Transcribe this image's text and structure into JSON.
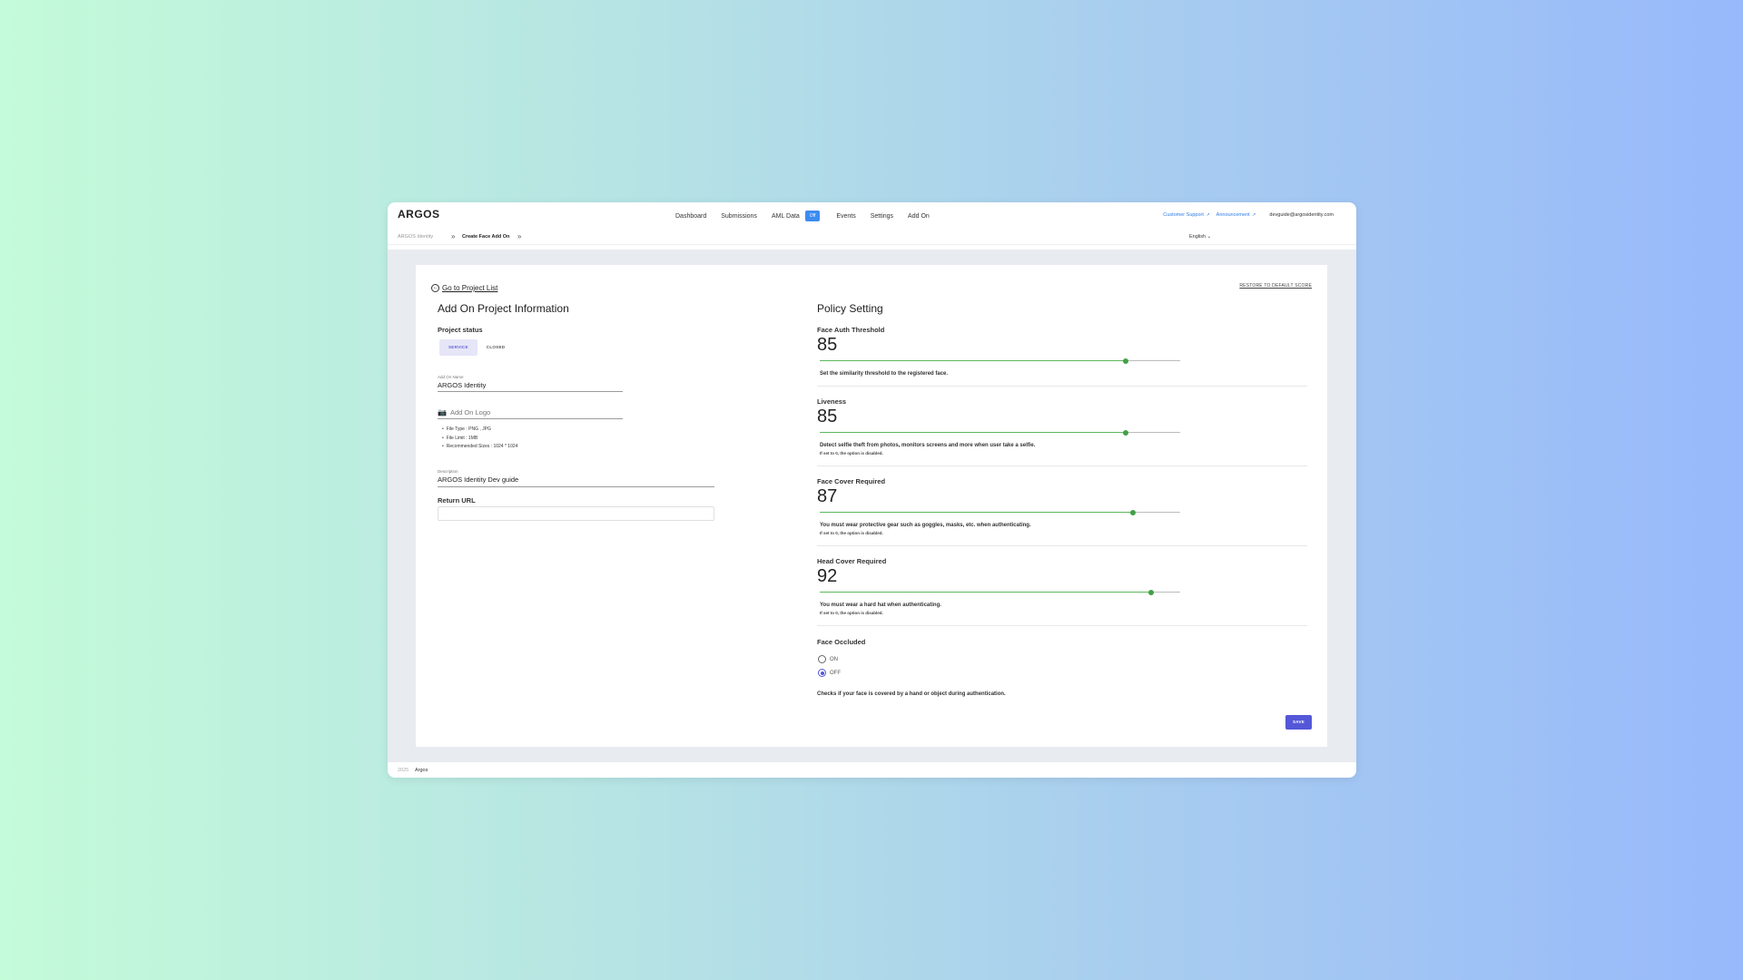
{
  "header": {
    "logo": "ARGOS",
    "nav": {
      "dashboard": "Dashboard",
      "submissions": "Submissions",
      "aml_data": "AML Data",
      "aml_badge": "Off",
      "events": "Events",
      "settings": "Settings",
      "add_on": "Add On"
    },
    "customer_support": "Customer Support",
    "announcement": "Announcement",
    "email": "devguide@argosidentity.com"
  },
  "breadcrumb": {
    "root": "ARGOS Identity",
    "current": "Create Face Add On"
  },
  "language": "English",
  "back_link": "Go to Project List",
  "restore_label": "RESTORE TO DEFAULT SCORE",
  "info": {
    "title": "Add On Project Information",
    "status_label": "Project status",
    "status_options": [
      "SERVICE",
      "CLOSED"
    ],
    "status_selected": "SERVICE",
    "name_label": "Add On Name",
    "name_value": "ARGOS Identity",
    "logo_label": "Add On Logo",
    "logo_notes": [
      "File Type : PNG , JPG",
      "File Limit : 1MB",
      "Recommended Sizes : 1024 * 1024"
    ],
    "description_label": "Description",
    "description_value": "ARGOS Identity Dev guide",
    "return_url_label": "Return URL",
    "return_url_value": ""
  },
  "policy": {
    "title": "Policy Setting",
    "face_auth": {
      "title": "Face Auth Threshold",
      "value": "85",
      "level": 85,
      "desc": "Set the similarity threshold to the registered face."
    },
    "liveness": {
      "title": "Liveness",
      "value": "85",
      "level": 85,
      "desc": "Detect selfie theft from photos, monitors screens and more when user take a selfie.",
      "note": "If set to 0, the option is disabled."
    },
    "face_cover": {
      "title": "Face Cover Required",
      "value": "87",
      "level": 87,
      "desc": "You must wear protective gear such as goggles, masks, etc. when authenticating.",
      "note": "If set to 0, the option is disabled."
    },
    "head_cover": {
      "title": "Head Cover Required",
      "value": "92",
      "level": 92,
      "desc": "You must wear a hard hat when authenticating.",
      "note": "If set to 0, the option is disabled."
    },
    "face_occluded": {
      "title": "Face Occluded",
      "options": [
        "ON",
        "OFF"
      ],
      "selected": "OFF",
      "desc": "Checks if your face is covered by a hand or object during authentication."
    }
  },
  "save_label": "SAVE",
  "footer": {
    "year": "2025",
    "brand": "Argos"
  },
  "colors": {
    "accent": "#5457d8",
    "slider": "#43a047",
    "link": "#2f7ee6",
    "badge": "#3d8cf0"
  }
}
